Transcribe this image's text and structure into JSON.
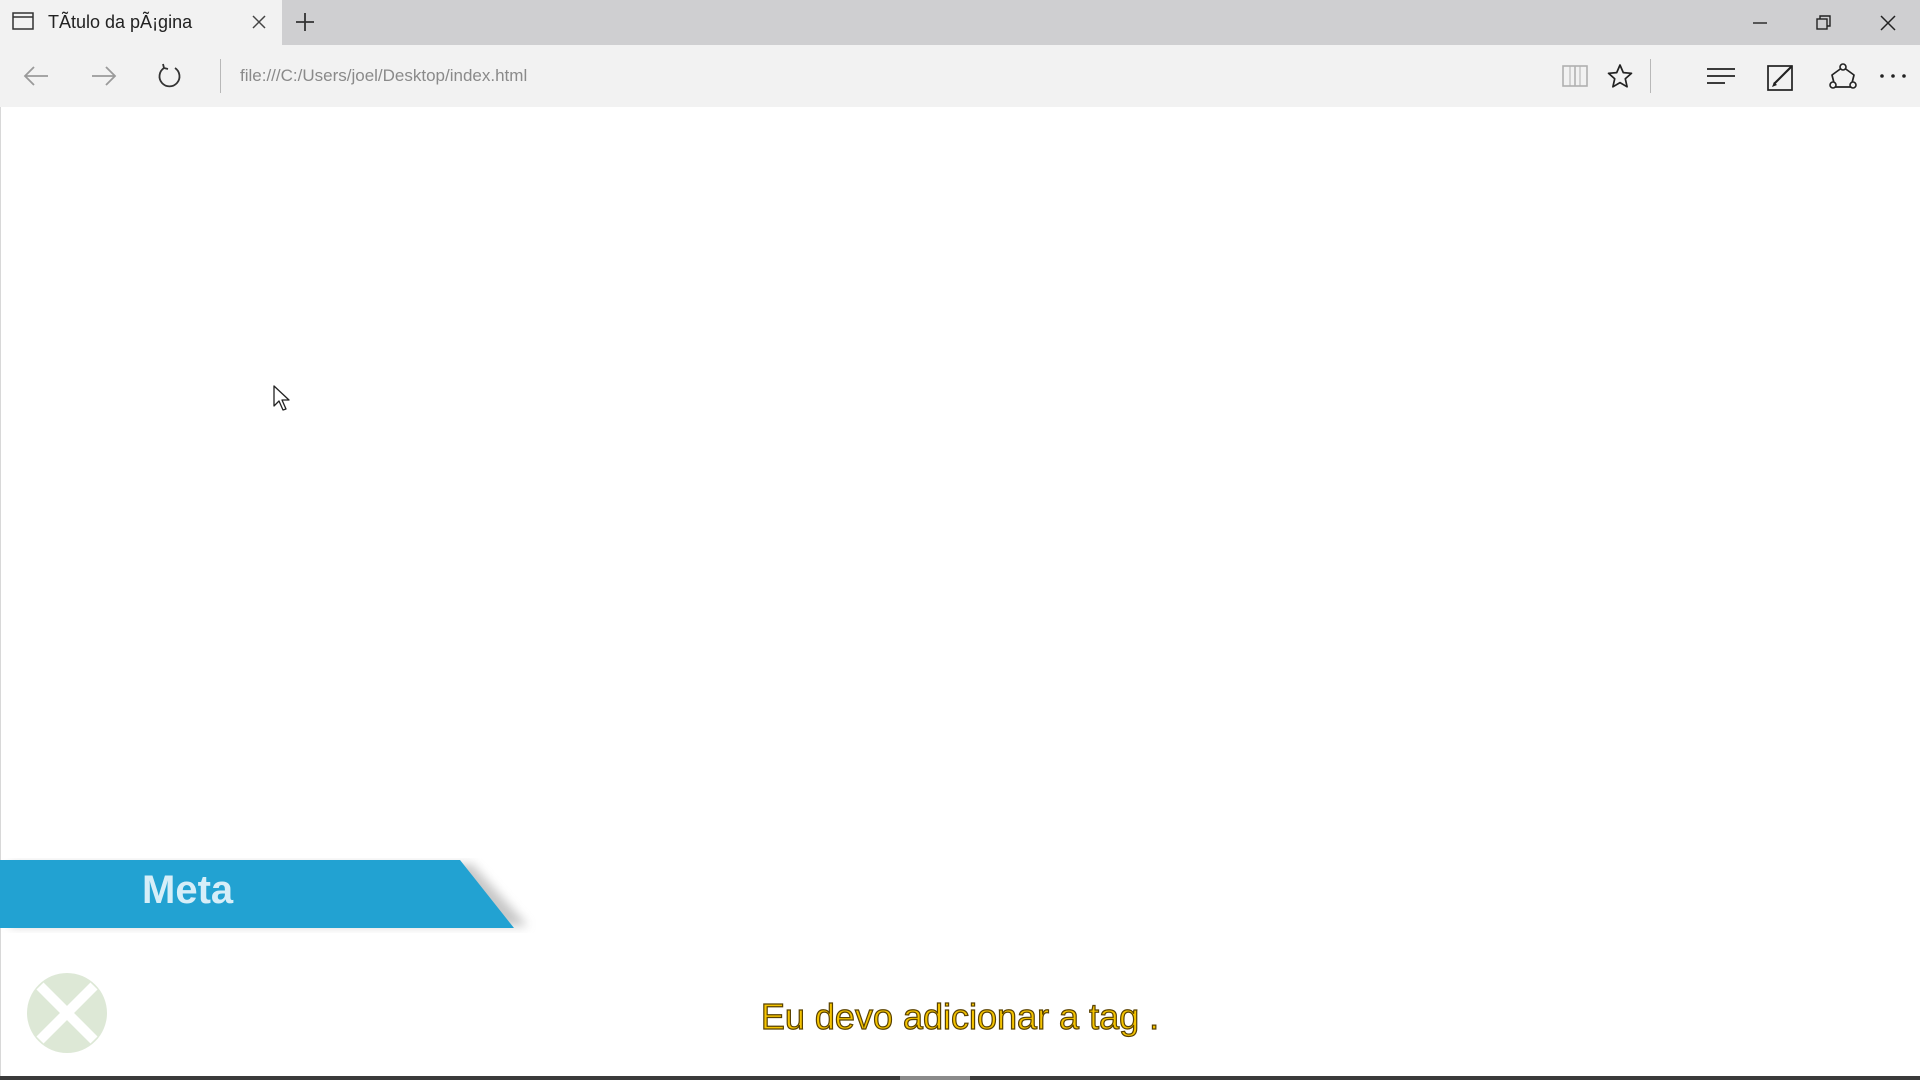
{
  "browser": {
    "tab": {
      "title": "TÃtulo da pÃ¡gina",
      "icon": "page-icon",
      "close_icon": "close-icon"
    },
    "new_tab_icon": "plus-icon",
    "window_controls": [
      "minimize-icon",
      "restore-icon",
      "close-icon"
    ],
    "nav": {
      "back_icon": "arrow-left-icon",
      "forward_icon": "arrow-right-icon",
      "refresh_icon": "refresh-icon"
    },
    "address": {
      "value": "file:///C:/Users/joel/Desktop/index.html"
    },
    "toolbar_icons": [
      "reading-view-icon",
      "star-icon",
      "hub-icon",
      "web-note-icon",
      "share-icon",
      "more-icon"
    ]
  },
  "page": {
    "banner_label": "Meta",
    "subtitle": "Eu devo adicionar a tag .",
    "colors": {
      "banner_blue": "#22a2d2",
      "banner_text": "#d6eef8",
      "subtitle_yellow": "#f5c400",
      "logo_green": "#dde8d6"
    }
  }
}
